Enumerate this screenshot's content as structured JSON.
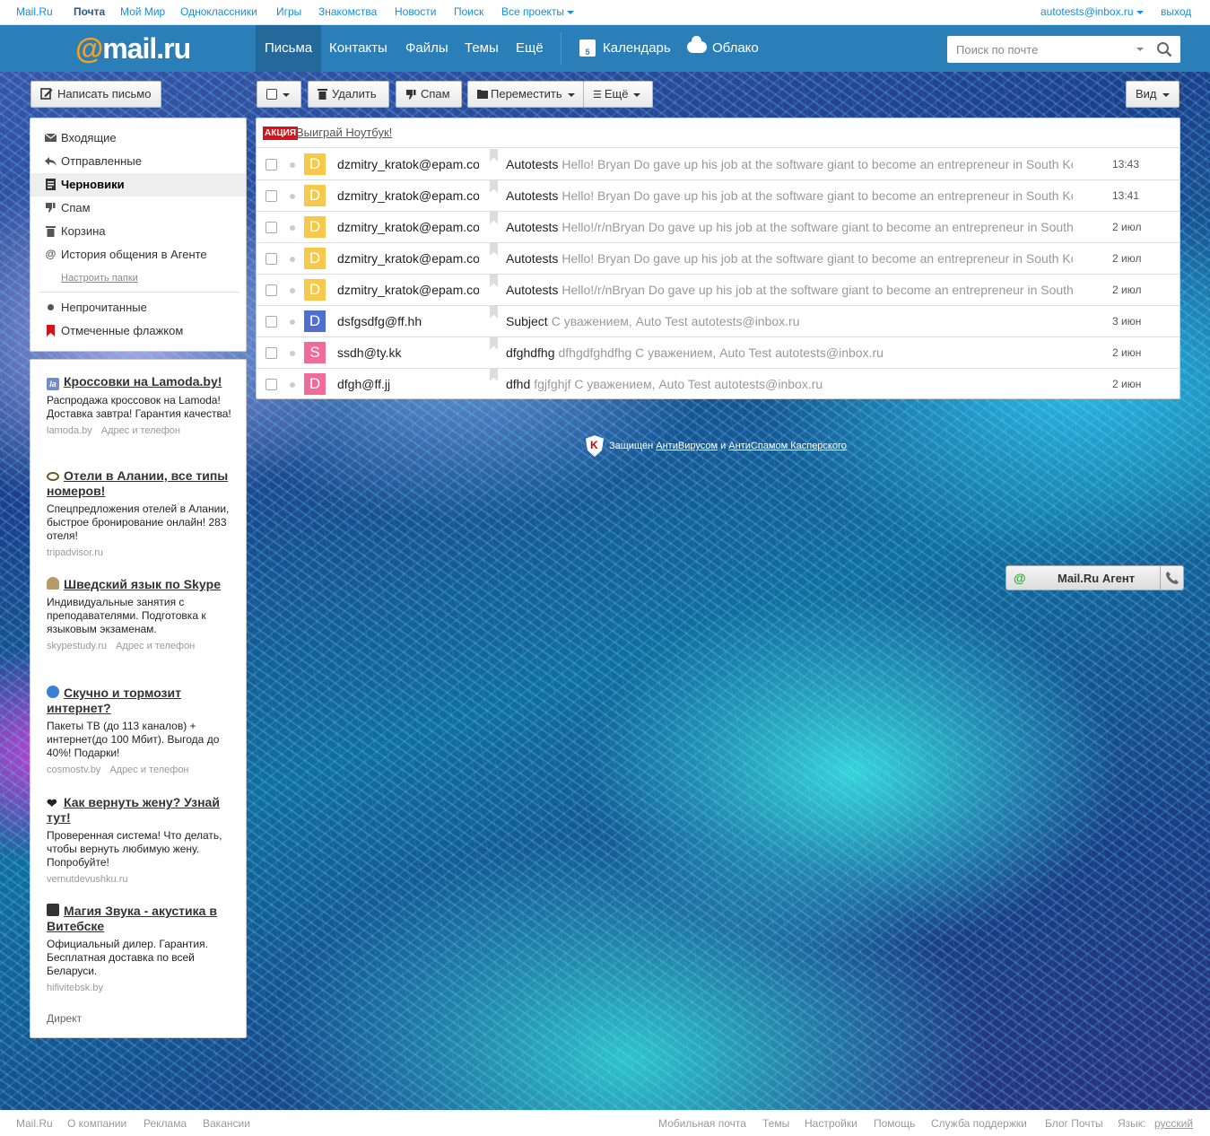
{
  "portal": {
    "links": [
      "Mail.Ru",
      "Почта",
      "Мой Мир",
      "Одноклассники",
      "Игры",
      "Знакомства",
      "Новости",
      "Поиск",
      "Все проекты"
    ],
    "user_email": "autotests@inbox.ru",
    "logout": "выход"
  },
  "header": {
    "logo_brand": "mail.ru",
    "nav": [
      "Письма",
      "Контакты",
      "Файлы",
      "Темы",
      "Ещё"
    ],
    "calendar": "Календарь",
    "calendar_day": "5",
    "cloud": "Облако",
    "search_placeholder": "Поиск по почте"
  },
  "toolbar": {
    "compose": "Написать письмо",
    "delete": "Удалить",
    "spam": "Спам",
    "move": "Переместить",
    "more": "Ещё",
    "view": "Вид"
  },
  "folders": [
    {
      "label": "Входящие",
      "icon": "envelope-icon"
    },
    {
      "label": "Отправленные",
      "icon": "reply-icon"
    },
    {
      "label": "Черновики",
      "icon": "draft-icon",
      "active": true
    },
    {
      "label": "Спам",
      "icon": "thumbs-down-icon"
    },
    {
      "label": "Корзина",
      "icon": "trash-icon"
    },
    {
      "label": "История общения в Агенте",
      "icon": "at-icon"
    }
  ],
  "setup_folders": "Настроить папки",
  "filters": [
    {
      "label": "Непрочитанные",
      "icon": "dot-icon"
    },
    {
      "label": "Отмеченные флажком",
      "icon": "flag-icon"
    }
  ],
  "promo": {
    "badge": "АКЦИЯ",
    "link": "Выиграй Ноутбук!"
  },
  "messages": [
    {
      "avatar": "D",
      "avatar_color": "#f6c94b",
      "from": "dzmitry_kratok@epam.com",
      "subject": "Autotests",
      "snippet": "Hello! Bryan Do gave up his job at the software giant to become an entrepreneur in South Korea, w",
      "date": "13:43"
    },
    {
      "avatar": "D",
      "avatar_color": "#f6c94b",
      "from": "dzmitry_kratok@epam.com",
      "subject": "Autotests",
      "snippet": "Hello! Bryan Do gave up his job at the software giant to become an entrepreneur in South Korea, w",
      "date": "13:41"
    },
    {
      "avatar": "D",
      "avatar_color": "#f6c94b",
      "from": "dzmitry_kratok@epam.com",
      "subject": "Autotests",
      "snippet": "Hello!/r/nBryan Do gave up his job at the software giant to become an entrepreneur in South Korea",
      "date": "2 июл"
    },
    {
      "avatar": "D",
      "avatar_color": "#f6c94b",
      "from": "dzmitry_kratok@epam.com",
      "subject": "Autotests",
      "snippet": "Hello! Bryan Do gave up his job at the software giant to become an entrepreneur in South Korea, w",
      "date": "2 июл"
    },
    {
      "avatar": "D",
      "avatar_color": "#f6c94b",
      "from": "dzmitry_kratok@epam.com",
      "subject": "Autotests",
      "snippet": "Hello!/r/nBryan Do gave up his job at the software giant to become an entrepreneur in South Korea",
      "date": "2 июл"
    },
    {
      "avatar": "D",
      "avatar_color": "#4e6fd1",
      "from": "dsfgsdfg@ff.hh",
      "subject": "Subject",
      "snippet": "С уважением, Auto Test autotests@inbox.ru",
      "date": "3 июн"
    },
    {
      "avatar": "S",
      "avatar_color": "#f06b9a",
      "from": "ssdh@ty.kk",
      "subject": "dfghdfhg",
      "snippet": "dfhgdfghdfhg С уважением, Auto Test autotests@inbox.ru",
      "date": "2 июн"
    },
    {
      "avatar": "D",
      "avatar_color": "#f06b9a",
      "from": "dfgh@ff.jj",
      "subject": "dfhd",
      "snippet": "fgjfghjf С уважением, Auto Test autotests@inbox.ru",
      "date": "2 июн"
    }
  ],
  "ads": [
    {
      "title": "Кроссовки на Lamoda.by!",
      "text": "Распродажа кроссовок на Lamoda! Доставка завтра! Гарантия качества!",
      "source": "lamoda.by",
      "extra": "Адрес и телефон",
      "icon": "lamoda-icon",
      "icon_color": "#6f8ecb"
    },
    {
      "title": "Отели в Алании, все типы номеров!",
      "text": "Спецпредложения отелей в Алании, быстрое бронирование онлайн! 283 отеля!",
      "source": "tripadvisor.ru",
      "extra": "",
      "icon": "owl-icon",
      "icon_color": "#6a5a2a"
    },
    {
      "title": "Шведский язык по Skype",
      "text": "Индивидуальные занятия с преподавателями. Подготовка к языковым экзаменам.",
      "source": "skypestudy.ru",
      "extra": "Адрес и телефон",
      "icon": "skype-study-icon",
      "icon_color": "#b79a6a"
    },
    {
      "title": "Скучно и тормозит интернет?",
      "text": "Пакеты ТВ (до 113 каналов) + интернет(до 100 Мбит). Выгода до 40%! Подарки!",
      "source": "cosmostv.by",
      "extra": "Адрес и телефон",
      "icon": "cosmos-icon",
      "icon_color": "#3a7fd6"
    },
    {
      "title": "Как вернуть жену? Узнай тут!",
      "text": "Проверенная система! Что делать, чтобы вернуть любимую жену. Попробуйте!",
      "source": "vernutdevushku.ru",
      "extra": "",
      "icon": "heart-icon",
      "icon_color": "#222"
    },
    {
      "title": "Магия Звука - акустика в Витебске",
      "text": "Официальный дилер. Гарантия. Бесплатная доставка по всей Беларуси.",
      "source": "hifivitebsk.by",
      "extra": "",
      "icon": "speaker-icon",
      "icon_color": "#333"
    }
  ],
  "direct": "Директ",
  "kaspersky": {
    "prefix": "Защищён",
    "antivirus": "АнтиВирусом",
    "and": "и",
    "antispam": "АнтиСпамом Касперского"
  },
  "agent": {
    "label": "Mail.Ru Агент"
  },
  "footer": {
    "left": [
      "Mail.Ru",
      "О компании",
      "Реклама",
      "Вакансии"
    ],
    "right": [
      "Мобильная почта",
      "Темы",
      "Настройки",
      "Помощь",
      "Служба поддержки",
      "Блог Почты"
    ],
    "lang_label": "Язык:",
    "lang": "русский"
  }
}
